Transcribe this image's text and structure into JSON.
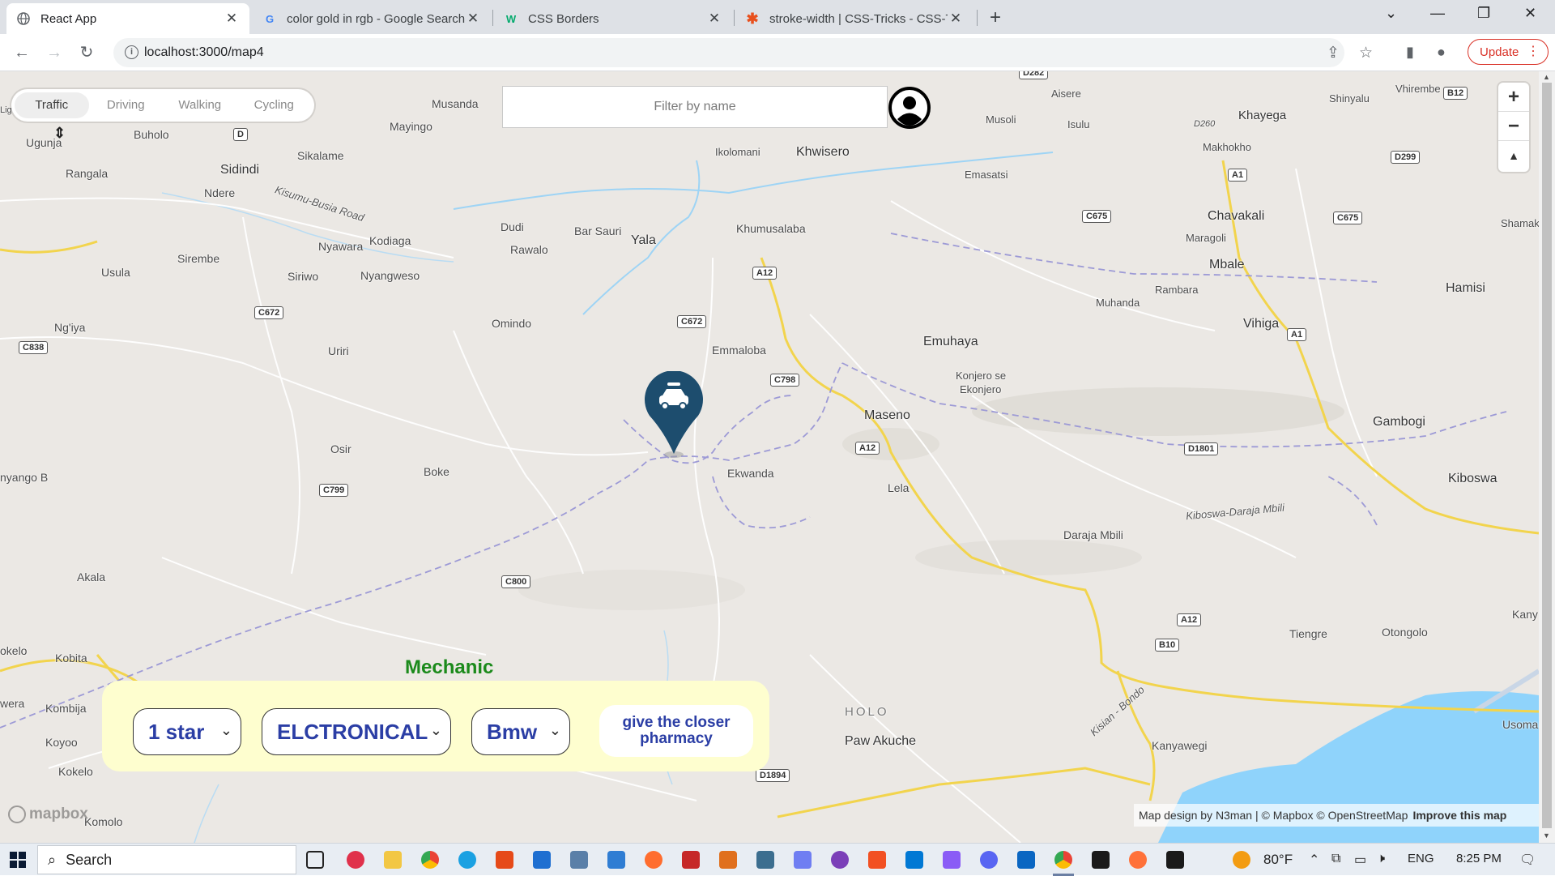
{
  "browser": {
    "tabs": [
      {
        "title": "React App",
        "favicon": "globe-icon",
        "active": true
      },
      {
        "title": "color gold in rgb - Google Search",
        "favicon": "google-icon",
        "active": false
      },
      {
        "title": "CSS Borders",
        "favicon": "w3schools-icon",
        "active": false
      },
      {
        "title": "stroke-width | CSS-Tricks - CSS-Tricks",
        "favicon": "csstricks-icon",
        "active": false
      }
    ],
    "url": "localhost:3000/map4",
    "update_label": "Update"
  },
  "map": {
    "modes": [
      "Traffic",
      "Driving",
      "Walking",
      "Cycling"
    ],
    "active_mode": "Traffic",
    "filter_placeholder": "Filter by name",
    "places": [
      {
        "label": "Musanda"
      },
      {
        "label": "Mayingo"
      },
      {
        "label": "Buholo"
      },
      {
        "label": "Ugunja"
      },
      {
        "label": "Sidindi"
      },
      {
        "label": "Sikalame"
      },
      {
        "label": "Rangala"
      },
      {
        "label": "Ndere"
      },
      {
        "label": "Kisumu-Busia Road"
      },
      {
        "label": "Dudi"
      },
      {
        "label": "Bar Sauri"
      },
      {
        "label": "Yala"
      },
      {
        "label": "Rawalo"
      },
      {
        "label": "Nyawara"
      },
      {
        "label": "Kodiaga"
      },
      {
        "label": "Sirembe"
      },
      {
        "label": "Usula"
      },
      {
        "label": "Siriwo"
      },
      {
        "label": "Nyangweso"
      },
      {
        "label": "Ng'iya"
      },
      {
        "label": "Omindo"
      },
      {
        "label": "Uriri"
      },
      {
        "label": "Emmaloba"
      },
      {
        "label": "Ikolomani"
      },
      {
        "label": "Khwisero"
      },
      {
        "label": "Khumusalaba"
      },
      {
        "label": "Aisere"
      },
      {
        "label": "Musoli"
      },
      {
        "label": "Isulu"
      },
      {
        "label": "Emasatsi"
      },
      {
        "label": "Khayega"
      },
      {
        "label": "Makhokho"
      },
      {
        "label": "Shinyalu"
      },
      {
        "label": "Vhirembe"
      },
      {
        "label": "Chavakali"
      },
      {
        "label": "Maragoli"
      },
      {
        "label": "Mbale"
      },
      {
        "label": "Shamak"
      },
      {
        "label": "Rambara"
      },
      {
        "label": "Muhanda"
      },
      {
        "label": "Hamisi"
      },
      {
        "label": "Vihiga"
      },
      {
        "label": "Emuhaya"
      },
      {
        "label": "Konjero se"
      },
      {
        "label": "Ekonjero"
      },
      {
        "label": "Maseno"
      },
      {
        "label": "Gambogi"
      },
      {
        "label": "Osir"
      },
      {
        "label": "Boke"
      },
      {
        "label": "Ekwanda"
      },
      {
        "label": "Lela"
      },
      {
        "label": "nyango B"
      },
      {
        "label": "Kiboswa"
      },
      {
        "label": "Kiboswa-Daraja Mbili"
      },
      {
        "label": "Daraja Mbili"
      },
      {
        "label": "Akala"
      },
      {
        "label": "Tiengre"
      },
      {
        "label": "Otongolo"
      },
      {
        "label": "Kany"
      },
      {
        "label": "okelo"
      },
      {
        "label": "Kobita"
      },
      {
        "label": "wera"
      },
      {
        "label": "Kombija"
      },
      {
        "label": "Koyoo"
      },
      {
        "label": "Kokelo"
      },
      {
        "label": "Komolo"
      },
      {
        "label": "HOLO"
      },
      {
        "label": "Paw Akuche"
      },
      {
        "label": "Kisian - Bondo"
      },
      {
        "label": "Kanyawegi"
      },
      {
        "label": "Usoma"
      },
      {
        "label": "Lig"
      }
    ],
    "shields": [
      "D",
      "C672",
      "C838",
      "C672",
      "A12",
      "C798",
      "A12",
      "C799",
      "C800",
      "D1894",
      "D1801",
      "C675",
      "C675",
      "A1",
      "D299",
      "B12",
      "A1",
      "A12",
      "B10",
      "D260",
      "D282"
    ],
    "attribution": "Map design by N3man | © Mapbox © OpenStreetMap",
    "improve_label": "Improve this map",
    "logo_text": "mapbox"
  },
  "panel": {
    "title": "Mechanic",
    "rating": "1 star",
    "category": "ELCTRONICAL",
    "brand": "Bmw",
    "button": "give the closer pharmacy"
  },
  "taskbar": {
    "search_label": "Search",
    "temperature": "80°F",
    "language": "ENG",
    "time": "8:25 PM"
  },
  "colors": {
    "panel_bg": "#fefecf",
    "panel_title": "#1b8a1b",
    "select_text": "#2b3ea5",
    "pin": "#1d4d6e",
    "water": "#8fd3fb",
    "road_yellow": "#f2d44d"
  }
}
